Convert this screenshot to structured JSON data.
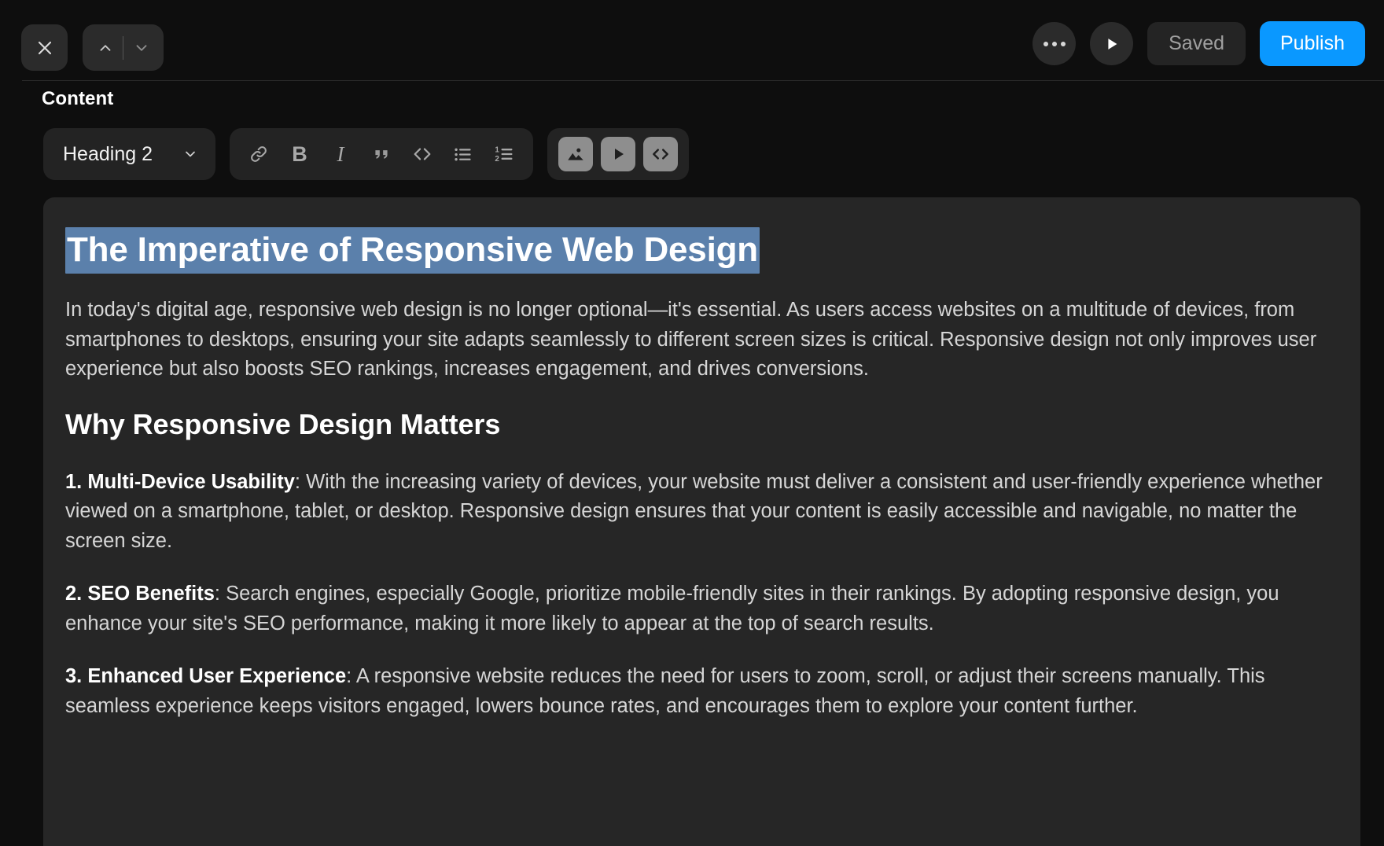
{
  "topbar": {
    "close_label": "×",
    "nav_up_icon": "chevron-up-icon",
    "nav_down_icon": "chevron-down-icon",
    "more_label": "•••",
    "preview_icon": "play-icon",
    "saved_label": "Saved",
    "publish_label": "Publish",
    "publish_color": "#0a98ff"
  },
  "section": {
    "label": "Content"
  },
  "toolbar": {
    "block_type": "Heading 2",
    "chevron": "⌄",
    "format_buttons": [
      {
        "name": "link-icon",
        "label": "Link"
      },
      {
        "name": "bold-icon",
        "label": "B"
      },
      {
        "name": "italic-icon",
        "label": "I"
      },
      {
        "name": "quote-icon",
        "label": "“"
      },
      {
        "name": "code-icon",
        "label": "</>"
      },
      {
        "name": "bullet-list-icon",
        "label": "Bulleted list"
      },
      {
        "name": "numbered-list-icon",
        "label": "Numbered list"
      }
    ],
    "media_buttons": [
      {
        "name": "image-icon",
        "label": "Insert image"
      },
      {
        "name": "video-icon",
        "label": "Insert video"
      },
      {
        "name": "embed-code-icon",
        "label": "Insert embed"
      }
    ]
  },
  "document": {
    "title": "The Imperative of Responsive Web Design",
    "title_selected": true,
    "selection_color": "#5b80ab",
    "intro": "In today's digital age, responsive web design is no longer optional—it's essential. As users access websites on a multitude of devices, from smartphones to desktops, ensuring your site adapts seamlessly to different screen sizes is critical. Responsive design not only improves user experience but also boosts SEO rankings, increases engagement, and drives conversions.",
    "heading2": "Why Responsive Design Matters",
    "points": [
      {
        "label": "1. Multi-Device Usability",
        "body": ": With the increasing variety of devices, your website must deliver a consistent and user-friendly experience whether viewed on a smartphone, tablet, or desktop. Responsive design ensures that your content is easily accessible and navigable, no matter the screen size."
      },
      {
        "label": "2. SEO Benefits",
        "body": ": Search engines, especially Google, prioritize mobile-friendly sites in their rankings. By adopting responsive design, you enhance your site's SEO performance, making it more likely to appear at the top of search results."
      },
      {
        "label": "3. Enhanced User Experience",
        "body": ": A responsive website reduces the need for users to zoom, scroll, or adjust their screens manually. This seamless experience keeps visitors engaged, lowers bounce rates, and encourages them to explore your content further."
      }
    ]
  }
}
